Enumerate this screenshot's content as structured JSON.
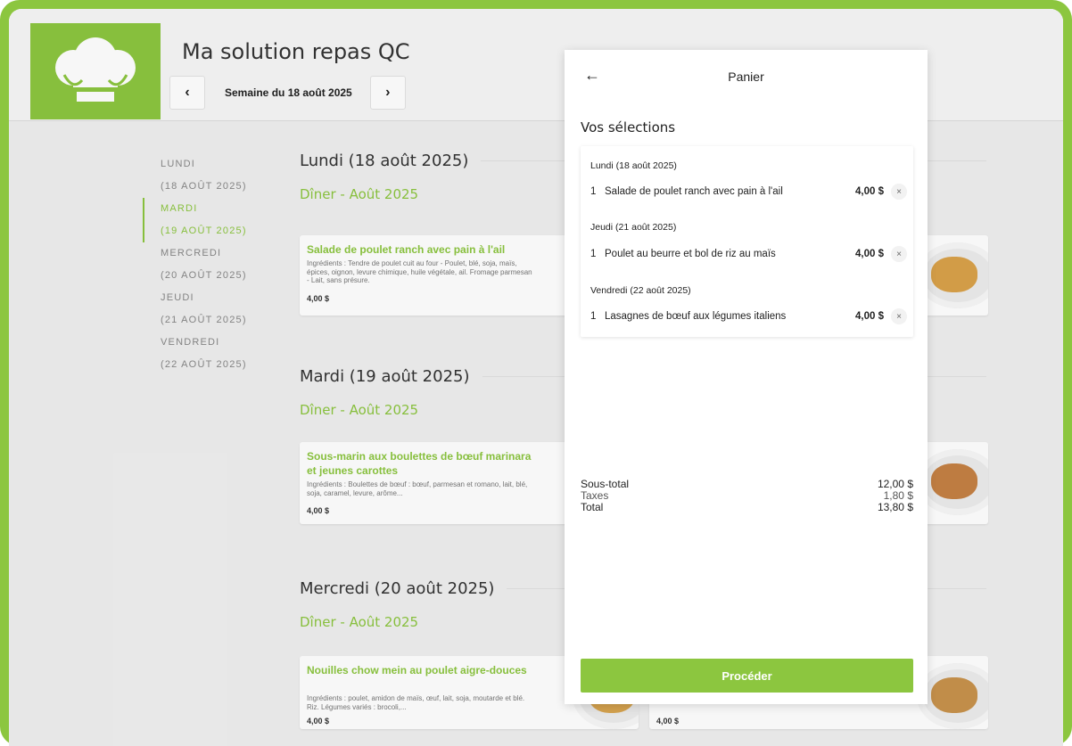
{
  "header": {
    "title": "Ma solution repas QC",
    "week_label": "Semaine du 18 août 2025",
    "prev_glyph": "‹",
    "next_glyph": "›"
  },
  "sidebar": {
    "items": [
      {
        "line1": "LUNDI",
        "line2": "(18 AOÛT 2025)"
      },
      {
        "line1": "MARDI",
        "line2": "(19 AOÛT 2025)"
      },
      {
        "line1": "MERCREDI",
        "line2": "(20 AOÛT 2025)"
      },
      {
        "line1": "JEUDI",
        "line2": "(21 AOÛT 2025)"
      },
      {
        "line1": "VENDREDI",
        "line2": "(22 AOÛT 2025)"
      }
    ]
  },
  "days": [
    {
      "title": "Lundi (18 août 2025)",
      "meal": "Dîner - Août 2025",
      "card": {
        "name": "Salade de poulet ranch avec pain à l'ail",
        "ingredients": "Ingrédients : Tendre de poulet cuit au four - Poulet, blé, soja, maïs, épices, oignon, levure chimique, huile végétale, ail. Fromage parmesan - Lait, sans présure.",
        "price": "4,00 $"
      }
    },
    {
      "title": "Mardi (19 août 2025)",
      "meal": "Dîner - Août 2025",
      "card": {
        "name": "Sous-marin aux boulettes de bœuf marinara et jeunes carottes",
        "ingredients": "Ingrédients : Boulettes de bœuf : bœuf, parmesan et romano, lait, blé, soja, caramel, levure, arôme...",
        "price": "4,00 $"
      }
    },
    {
      "title": "Mercredi (20 août 2025)",
      "meal": "Dîner - Août 2025",
      "card": {
        "name": "Nouilles chow mein au poulet aigre-douces",
        "ingredients": "Ingrédients : poulet, amidon de maïs, œuf, lait, soja, moutarde et blé. Riz. Légumes variés : brocoli,...",
        "price": "4,00 $"
      },
      "right_price": "4,00 $"
    }
  ],
  "cart": {
    "back_glyph": "←",
    "title": "Panier",
    "subtitle": "Vos sélections",
    "groups": [
      {
        "day": "Lundi (18 août 2025)",
        "qty": "1",
        "name": "Salade de poulet ranch avec pain à l'ail",
        "price": "4,00 $"
      },
      {
        "day": "Jeudi (21 août 2025)",
        "qty": "1",
        "name": "Poulet au beurre et bol de riz au maïs",
        "price": "4,00 $"
      },
      {
        "day": "Vendredi (22 août 2025)",
        "qty": "1",
        "name": "Lasagnes de bœuf aux légumes italiens",
        "price": "4,00 $"
      }
    ],
    "remove_glyph": "×",
    "subtotal_label": "Sous-total",
    "subtotal": "12,00 $",
    "taxes_label": "Taxes",
    "taxes": "1,80 $",
    "total_label": "Total",
    "total": "13,80 $",
    "proceed_label": "Procéder"
  },
  "colors": {
    "accent": "#8cc63f",
    "background": "#efefef"
  }
}
